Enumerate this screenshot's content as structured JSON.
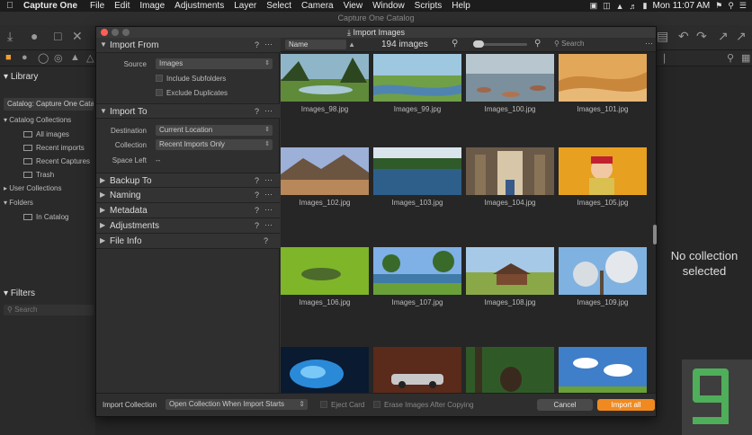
{
  "menubar": {
    "app_name": "Capture One",
    "items": [
      "File",
      "Edit",
      "Image",
      "Adjustments",
      "Layer",
      "Select",
      "Camera",
      "View",
      "Window",
      "Scripts",
      "Help"
    ],
    "clock": "Mon 11:07 AM"
  },
  "main_window": {
    "title": "Capture One Catalog",
    "no_collection_text": "No collection selected"
  },
  "library": {
    "title": "Library",
    "catalog_selector": "Catalog: Capture One Catalog",
    "catalog_collections": "Catalog Collections",
    "items": [
      "All images",
      "Recent imports",
      "Recent Captures",
      "Trash"
    ],
    "user_collections": "User Collections",
    "folders": "Folders",
    "in_catalog": "In Catalog"
  },
  "filters": {
    "title": "Filters",
    "search_placeholder": "Search"
  },
  "dialog": {
    "title": "Import Images",
    "import_from": {
      "title": "Import From",
      "source_label": "Source",
      "source_value": "Images",
      "include_subfolders": "Include Subfolders",
      "exclude_duplicates": "Exclude Duplicates"
    },
    "import_to": {
      "title": "Import To",
      "destination_label": "Destination",
      "destination_value": "Current Location",
      "collection_label": "Collection",
      "collection_value": "Recent Imports Only",
      "space_left_label": "Space Left",
      "space_left_value": "--"
    },
    "sections": [
      "Backup To",
      "Naming",
      "Metadata",
      "Adjustments",
      "File Info"
    ],
    "help_glyph": "?",
    "more_glyph": "···",
    "browser": {
      "sort_value": "Name",
      "count": "194 images",
      "search_placeholder": "Search",
      "images": [
        {
          "name": "Images_98.jpg",
          "scene": "forest-lake"
        },
        {
          "name": "Images_99.jpg",
          "scene": "river-meadow"
        },
        {
          "name": "Images_100.jpg",
          "scene": "rocky-shore"
        },
        {
          "name": "Images_101.jpg",
          "scene": "desert"
        },
        {
          "name": "Images_102.jpg",
          "scene": "mountain-sunset"
        },
        {
          "name": "Images_103.jpg",
          "scene": "lake-forest"
        },
        {
          "name": "Images_104.jpg",
          "scene": "cathedral"
        },
        {
          "name": "Images_105.jpg",
          "scene": "child-portrait"
        },
        {
          "name": "Images_106.jpg",
          "scene": "green-moss"
        },
        {
          "name": "Images_107.jpg",
          "scene": "lake-trees"
        },
        {
          "name": "Images_108.jpg",
          "scene": "hut-field"
        },
        {
          "name": "Images_109.jpg",
          "scene": "blossom-tree"
        },
        {
          "name": "",
          "scene": "blue-feather"
        },
        {
          "name": "",
          "scene": "car-garage"
        },
        {
          "name": "",
          "scene": "bear-forest"
        },
        {
          "name": "",
          "scene": "clouds-field"
        }
      ]
    },
    "footer": {
      "import_collection_label": "Import Collection",
      "import_collection_value": "Open Collection When Import Starts",
      "eject_card": "Eject Card",
      "erase_images": "Erase Images After Copying",
      "cancel": "Cancel",
      "import_all": "Import all"
    }
  },
  "colors": {
    "accent": "#f08a20",
    "watermark": "#4fae5a"
  }
}
